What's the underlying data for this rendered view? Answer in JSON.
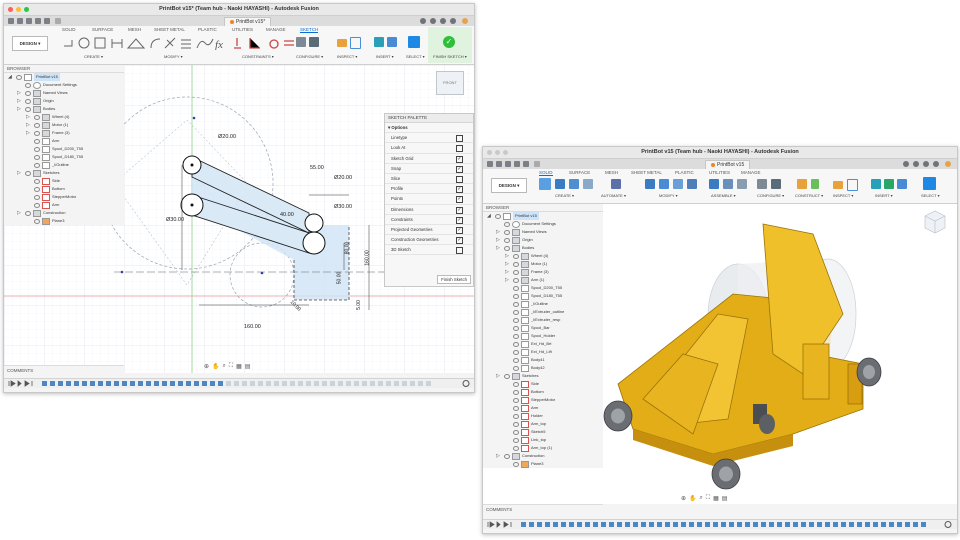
{
  "left": {
    "window_title": "PrintBot v15* (Team hub - Naoki HAYASHI) - Autodesk Fusion",
    "doc_tab": "PrintBot v15*",
    "ribbon_tabs": [
      "SOLID",
      "SURFACE",
      "MESH",
      "SHEET METAL",
      "PLASTIC",
      "UTILITIES",
      "MANAGE",
      "SKETCH"
    ],
    "design_label": "DESIGN ▾",
    "groups": [
      "CREATE ▾",
      "MODIFY ▾",
      "CONSTRAINTS ▾",
      "CONFIGURE ▾",
      "INSPECT ▾",
      "INSERT ▾",
      "SELECT ▾",
      "FINISH SKETCH ▾"
    ],
    "browser_title": "BROWSER",
    "tree": [
      {
        "label": "PrintBot v15",
        "indent": 0,
        "kind": "root"
      },
      {
        "label": "Document Settings",
        "indent": 1,
        "kind": "gear"
      },
      {
        "label": "Named Views",
        "indent": 1,
        "kind": "folder"
      },
      {
        "label": "Origin",
        "indent": 1,
        "kind": "folder"
      },
      {
        "label": "Bodies",
        "indent": 1,
        "kind": "folder"
      },
      {
        "label": "Wheel (4)",
        "indent": 2,
        "kind": "folder"
      },
      {
        "label": "Motor (1)",
        "indent": 2,
        "kind": "folder"
      },
      {
        "label": "Frame (3)",
        "indent": 2,
        "kind": "folder"
      },
      {
        "label": "Arm",
        "indent": 2,
        "kind": "body"
      },
      {
        "label": "Spool_D200_T55",
        "indent": 2,
        "kind": "body"
      },
      {
        "label": "Spool_D180_T55",
        "indent": 2,
        "kind": "body"
      },
      {
        "label": "_l/Outline",
        "indent": 2,
        "kind": "body"
      },
      {
        "label": "Sketches",
        "indent": 1,
        "kind": "folder"
      },
      {
        "label": "Side",
        "indent": 2,
        "kind": "sketch"
      },
      {
        "label": "Bottom",
        "indent": 2,
        "kind": "sketch"
      },
      {
        "label": "StepperMotor",
        "indent": 2,
        "kind": "sketch"
      },
      {
        "label": "Arm",
        "indent": 2,
        "kind": "sketch"
      },
      {
        "label": "Construction",
        "indent": 1,
        "kind": "folder"
      },
      {
        "label": "Plane3",
        "indent": 2,
        "kind": "plane"
      }
    ],
    "comments_label": "COMMENTS",
    "palette": {
      "title": "SKETCH PALETTE",
      "options_label": "▾ Options",
      "rows": [
        {
          "label": "Linetype",
          "mark": ""
        },
        {
          "label": "Look At",
          "mark": ""
        },
        {
          "label": "Sketch Grid",
          "mark": "✓"
        },
        {
          "label": "Snap",
          "mark": "✓"
        },
        {
          "label": "Slice",
          "mark": ""
        },
        {
          "label": "Profile",
          "mark": "✓"
        },
        {
          "label": "Points",
          "mark": "✓"
        },
        {
          "label": "Dimensions",
          "mark": "✓"
        },
        {
          "label": "Constraints",
          "mark": "✓"
        },
        {
          "label": "Projected Geometries",
          "mark": "✓"
        },
        {
          "label": "Construction Geometries",
          "mark": "✓"
        },
        {
          "label": "3D Sketch",
          "mark": ""
        }
      ],
      "finish": "Finish Sketch"
    },
    "dims": {
      "d20_top": "Ø20.00",
      "d20_right": "Ø20.00",
      "d30_left": "Ø30.00",
      "d30_right": "Ø30.00",
      "d55": "55.00",
      "d40": "40.00",
      "d160h": "160.00",
      "d160v": "160.00",
      "d50": "50.00",
      "d10": "10.00",
      "d5": "5.00",
      "d80": "80.00"
    },
    "viewcube": "FRONT"
  },
  "right": {
    "window_title": "PrintBot v15 (Team hub - Naoki HAYASHI) - Autodesk Fusion",
    "doc_tab": "PrintBot v15",
    "ribbon_tabs": [
      "SOLID",
      "SURFACE",
      "MESH",
      "SHEET METAL",
      "PLASTIC",
      "UTILITIES",
      "MANAGE"
    ],
    "design_label": "DESIGN ▾",
    "groups": [
      "CREATE ▾",
      "AUTOMATE ▾",
      "MODIFY ▾",
      "ASSEMBLE ▾",
      "CONFIGURE ▾",
      "CONSTRUCT ▾",
      "INSPECT ▾",
      "INSERT ▾",
      "SELECT ▾"
    ],
    "browser_title": "BROWSER",
    "tree": [
      {
        "label": "PrintBot v15",
        "indent": 0,
        "kind": "root"
      },
      {
        "label": "Document Settings",
        "indent": 1,
        "kind": "gear"
      },
      {
        "label": "Named Views",
        "indent": 1,
        "kind": "folder"
      },
      {
        "label": "Origin",
        "indent": 1,
        "kind": "folder"
      },
      {
        "label": "Bodies",
        "indent": 1,
        "kind": "folder"
      },
      {
        "label": "Wheel (4)",
        "indent": 2,
        "kind": "folder"
      },
      {
        "label": "Motor (1)",
        "indent": 2,
        "kind": "folder"
      },
      {
        "label": "Frame (3)",
        "indent": 2,
        "kind": "folder"
      },
      {
        "label": "Arm (1)",
        "indent": 2,
        "kind": "folder"
      },
      {
        "label": "Spool_D200_T55",
        "indent": 2,
        "kind": "body"
      },
      {
        "label": "Spool_D180_T55",
        "indent": 2,
        "kind": "body"
      },
      {
        "label": "_l/Outline",
        "indent": 2,
        "kind": "body"
      },
      {
        "label": "_l/Extruder_outline",
        "indent": 2,
        "kind": "body"
      },
      {
        "label": "_l/Extruder_resp",
        "indent": 2,
        "kind": "body"
      },
      {
        "label": "Spool_Bar",
        "indent": 2,
        "kind": "body"
      },
      {
        "label": "Spool_Holder",
        "indent": 2,
        "kind": "body"
      },
      {
        "label": "Ext_Hd_Brt",
        "indent": 2,
        "kind": "body"
      },
      {
        "label": "Ext_Hd_Lift",
        "indent": 2,
        "kind": "body"
      },
      {
        "label": "Body41",
        "indent": 2,
        "kind": "body"
      },
      {
        "label": "Body42",
        "indent": 2,
        "kind": "body"
      },
      {
        "label": "Sketches",
        "indent": 1,
        "kind": "folder"
      },
      {
        "label": "Side",
        "indent": 2,
        "kind": "sketch"
      },
      {
        "label": "Bottom",
        "indent": 2,
        "kind": "sketch"
      },
      {
        "label": "StepperMotor",
        "indent": 2,
        "kind": "sketch"
      },
      {
        "label": "Arm",
        "indent": 2,
        "kind": "sketch"
      },
      {
        "label": "Holder",
        "indent": 2,
        "kind": "sketch"
      },
      {
        "label": "Arm_top",
        "indent": 2,
        "kind": "sketch"
      },
      {
        "label": "Sketch5",
        "indent": 2,
        "kind": "sketch"
      },
      {
        "label": "Link_top",
        "indent": 2,
        "kind": "sketch"
      },
      {
        "label": "Arm_top (1)",
        "indent": 2,
        "kind": "sketch"
      },
      {
        "label": "Construction",
        "indent": 1,
        "kind": "folder"
      },
      {
        "label": "Plane3",
        "indent": 2,
        "kind": "plane"
      }
    ],
    "comments_label": "COMMENTS"
  },
  "colors": {
    "accent": "#0a6ed1",
    "sketch_fill": "#cfe3f5",
    "part_yellow": "#e9b51a",
    "finish_green": "#2fbf3a"
  }
}
